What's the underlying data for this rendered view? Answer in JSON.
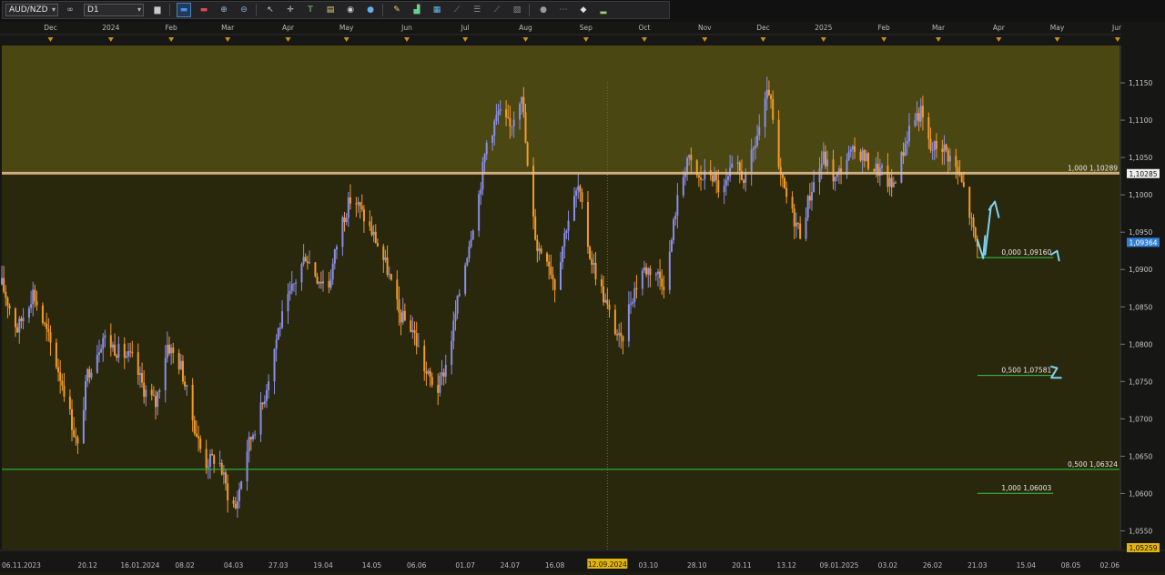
{
  "toolbar": {
    "symbol": "AUD/NZD",
    "period": "D1",
    "buttons": [
      {
        "name": "chart-type-icon",
        "glyph": "▆",
        "color": "#c9c9c9"
      },
      {
        "name": "candle-blue-icon",
        "glyph": "▬",
        "color": "#4a8fe0"
      },
      {
        "name": "candle-red-icon",
        "glyph": "▬",
        "color": "#e04a4a"
      },
      {
        "name": "zoom-in-icon",
        "glyph": "⊕",
        "color": "#8fb3e8"
      },
      {
        "name": "zoom-out-icon",
        "glyph": "⊖",
        "color": "#8fb3e8"
      },
      {
        "name": "cursor-icon",
        "glyph": "↖",
        "color": "#cfcfcf"
      },
      {
        "name": "crosshair-icon",
        "glyph": "✛",
        "color": "#cfcfcf"
      },
      {
        "name": "text-tool-icon",
        "glyph": "T",
        "color": "#9ad06a"
      },
      {
        "name": "note-icon",
        "glyph": "▤",
        "color": "#e8d36a"
      },
      {
        "name": "camera-icon",
        "glyph": "◉",
        "color": "#cfcfcf"
      },
      {
        "name": "globe-icon",
        "glyph": "●",
        "color": "#6aaee8"
      },
      {
        "name": "pencil-icon",
        "glyph": "✎",
        "color": "#f0d05a"
      },
      {
        "name": "indicator-icon",
        "glyph": "▟",
        "color": "#6ad08a"
      },
      {
        "name": "calculator-icon",
        "glyph": "▦",
        "color": "#6ab8e8"
      },
      {
        "name": "line-tool-icon",
        "glyph": "⟋",
        "color": "#8a8a8a"
      },
      {
        "name": "fibonacci-icon",
        "glyph": "☰",
        "color": "#8a8a8a"
      },
      {
        "name": "channel-icon",
        "glyph": "⟋",
        "color": "#8a8a8a"
      },
      {
        "name": "shapes-icon",
        "glyph": "▧",
        "color": "#8a8a8a"
      },
      {
        "name": "sphere-icon",
        "glyph": "●",
        "color": "#9a9a9a"
      },
      {
        "name": "more-icon",
        "glyph": "⋯",
        "color": "#8a8a8a"
      },
      {
        "name": "eraser-icon",
        "glyph": "◆",
        "color": "#e0e0e0"
      },
      {
        "name": "signal-icon",
        "glyph": "▂",
        "color": "#9ad06a"
      }
    ]
  },
  "chart_data": {
    "type": "candlestick",
    "symbol": "AUD/NZD",
    "timeframe": "D1",
    "colors": {
      "bull": "#8a8ee8",
      "bear": "#f29a2e",
      "premium_zone": "#4a4713",
      "discount_zone": "#29270c",
      "fib_line": "#35c84a",
      "resistance": "#e9c08e",
      "current_price": "#2f7fd6",
      "annotation": "#7fd2f0"
    },
    "x_dates": [
      "2023-11-06",
      "2025-06-02"
    ],
    "y_range": [
      1.0525,
      1.12
    ],
    "upper_zone": [
      1.1029,
      1.12
    ],
    "top_month_labels": [
      {
        "label": "Dec",
        "date": "2023-12-01"
      },
      {
        "label": "2024",
        "date": "2024-01-01"
      },
      {
        "label": "Feb",
        "date": "2024-02-01"
      },
      {
        "label": "Mar",
        "date": "2024-03-01"
      },
      {
        "label": "Apr",
        "date": "2024-04-01"
      },
      {
        "label": "May",
        "date": "2024-05-01"
      },
      {
        "label": "Jun",
        "date": "2024-06-01"
      },
      {
        "label": "Jul",
        "date": "2024-07-01"
      },
      {
        "label": "Aug",
        "date": "2024-08-01"
      },
      {
        "label": "Sep",
        "date": "2024-09-01"
      },
      {
        "label": "Oct",
        "date": "2024-10-01"
      },
      {
        "label": "Nov",
        "date": "2024-11-01"
      },
      {
        "label": "Dec",
        "date": "2024-12-01"
      },
      {
        "label": "2025",
        "date": "2025-01-01"
      },
      {
        "label": "Feb",
        "date": "2025-02-01"
      },
      {
        "label": "Mar",
        "date": "2025-03-01"
      },
      {
        "label": "Apr",
        "date": "2025-04-01"
      },
      {
        "label": "May",
        "date": "2025-05-01"
      },
      {
        "label": "Jun",
        "date": "2025-06-01"
      }
    ],
    "bottom_date_labels": [
      {
        "label": "06.11.2023",
        "date": "2023-11-06"
      },
      {
        "label": "20.12",
        "date": "2023-12-20"
      },
      {
        "label": "16.01.2024",
        "date": "2024-01-16"
      },
      {
        "label": "08.02",
        "date": "2024-02-08"
      },
      {
        "label": "04.03",
        "date": "2024-03-04"
      },
      {
        "label": "27.03",
        "date": "2024-03-27"
      },
      {
        "label": "19.04",
        "date": "2024-04-19"
      },
      {
        "label": "14.05",
        "date": "2024-05-14"
      },
      {
        "label": "06.06",
        "date": "2024-06-06"
      },
      {
        "label": "01.07",
        "date": "2024-07-01"
      },
      {
        "label": "24.07",
        "date": "2024-07-24"
      },
      {
        "label": "16.08",
        "date": "2024-08-16"
      },
      {
        "label": "03.10",
        "date": "2024-10-03"
      },
      {
        "label": "28.10",
        "date": "2024-10-28"
      },
      {
        "label": "20.11",
        "date": "2024-11-20"
      },
      {
        "label": "13.12",
        "date": "2024-12-13"
      },
      {
        "label": "09.01.2025",
        "date": "2025-01-09"
      },
      {
        "label": "03.02",
        "date": "2025-02-03"
      },
      {
        "label": "26.02",
        "date": "2025-02-26"
      },
      {
        "label": "21.03",
        "date": "2025-03-21"
      },
      {
        "label": "15.04",
        "date": "2025-04-15"
      },
      {
        "label": "08.05",
        "date": "2025-05-08"
      },
      {
        "label": "02.06",
        "date": "2025-06-02"
      }
    ],
    "crosshair_date": {
      "label": "12.09.2024",
      "date": "2024-09-12"
    },
    "y_ticks": [
      {
        "label": "1,1150",
        "value": 1.115
      },
      {
        "label": "1,1100",
        "value": 1.11
      },
      {
        "label": "1,1050",
        "value": 1.105
      },
      {
        "label": "1,1000",
        "value": 1.1
      },
      {
        "label": "1,0950",
        "value": 1.095
      },
      {
        "label": "1,0900",
        "value": 1.09
      },
      {
        "label": "1,0850",
        "value": 1.085
      },
      {
        "label": "1,0800",
        "value": 1.08
      },
      {
        "label": "1,0750",
        "value": 1.075
      },
      {
        "label": "1,0700",
        "value": 1.07
      },
      {
        "label": "1,0650",
        "value": 1.065
      },
      {
        "label": "1,0600",
        "value": 1.06
      },
      {
        "label": "1,0550",
        "value": 1.055
      }
    ],
    "price_badges": [
      {
        "label": "1,10285",
        "value": 1.10285,
        "style": "resistance"
      },
      {
        "label": "1,09364",
        "value": 1.09364,
        "style": "current"
      },
      {
        "label": "1,05259",
        "value": 1.05259,
        "style": "low"
      }
    ],
    "fib_levels": [
      {
        "label": "1,000 1,10289",
        "value": 1.10289,
        "from": "2023-11-06",
        "to": "2025-06-02",
        "style": "resistance"
      },
      {
        "label": "0,000 1,09160",
        "value": 1.0916,
        "from": "2025-03-21",
        "to": "2025-04-29",
        "style": "fib"
      },
      {
        "label": "0,500 1,07581",
        "value": 1.07581,
        "from": "2025-03-21",
        "to": "2025-04-29",
        "style": "fib"
      },
      {
        "label": "0,500 1,06324",
        "value": 1.06324,
        "from": "2023-11-06",
        "to": "2025-06-02",
        "style": "fib"
      },
      {
        "label": "1,000 1,06003",
        "value": 1.06003,
        "from": "2025-03-21",
        "to": "2025-04-29",
        "style": "fib"
      }
    ],
    "price_path": [
      [
        "2023-11-06",
        1.088
      ],
      [
        "2023-11-14",
        1.082
      ],
      [
        "2023-11-22",
        1.087
      ],
      [
        "2023-12-01",
        1.08
      ],
      [
        "2023-12-08",
        1.074
      ],
      [
        "2023-12-15",
        1.066
      ],
      [
        "2023-12-20",
        1.076
      ],
      [
        "2023-12-28",
        1.081
      ],
      [
        "2024-01-05",
        1.079
      ],
      [
        "2024-01-12",
        1.078
      ],
      [
        "2024-01-18",
        1.074
      ],
      [
        "2024-01-24",
        1.072
      ],
      [
        "2024-01-30",
        1.08
      ],
      [
        "2024-02-06",
        1.077
      ],
      [
        "2024-02-12",
        1.07
      ],
      [
        "2024-02-18",
        1.064
      ],
      [
        "2024-02-25",
        1.065
      ],
      [
        "2024-03-01",
        1.06
      ],
      [
        "2024-03-05",
        1.058
      ],
      [
        "2024-03-11",
        1.066
      ],
      [
        "2024-03-19",
        1.072
      ],
      [
        "2024-03-27",
        1.082
      ],
      [
        "2024-04-04",
        1.088
      ],
      [
        "2024-04-10",
        1.092
      ],
      [
        "2024-04-16",
        1.089
      ],
      [
        "2024-04-22",
        1.088
      ],
      [
        "2024-04-28",
        1.096
      ],
      [
        "2024-05-04",
        1.1
      ],
      [
        "2024-05-10",
        1.097
      ],
      [
        "2024-05-16",
        1.094
      ],
      [
        "2024-05-22",
        1.09
      ],
      [
        "2024-05-28",
        1.084
      ],
      [
        "2024-06-04",
        1.082
      ],
      [
        "2024-06-11",
        1.076
      ],
      [
        "2024-06-17",
        1.074
      ],
      [
        "2024-06-22",
        1.078
      ],
      [
        "2024-06-28",
        1.087
      ],
      [
        "2024-07-04",
        1.095
      ],
      [
        "2024-07-08",
        1.1
      ],
      [
        "2024-07-12",
        1.107
      ],
      [
        "2024-07-18",
        1.111
      ],
      [
        "2024-07-24",
        1.109
      ],
      [
        "2024-07-30",
        1.114
      ],
      [
        "2024-08-03",
        1.1
      ],
      [
        "2024-08-07",
        1.093
      ],
      [
        "2024-08-12",
        1.092
      ],
      [
        "2024-08-16",
        1.088
      ],
      [
        "2024-08-22",
        1.096
      ],
      [
        "2024-08-28",
        1.101
      ],
      [
        "2024-09-03",
        1.092
      ],
      [
        "2024-09-08",
        1.088
      ],
      [
        "2024-09-13",
        1.084
      ],
      [
        "2024-09-19",
        1.08
      ],
      [
        "2024-09-24",
        1.086
      ],
      [
        "2024-09-30",
        1.09
      ],
      [
        "2024-10-06",
        1.09
      ],
      [
        "2024-10-12",
        1.088
      ],
      [
        "2024-10-17",
        1.098
      ],
      [
        "2024-10-23",
        1.105
      ],
      [
        "2024-10-29",
        1.102
      ],
      [
        "2024-11-04",
        1.103
      ],
      [
        "2024-11-10",
        1.1
      ],
      [
        "2024-11-16",
        1.104
      ],
      [
        "2024-11-22",
        1.102
      ],
      [
        "2024-11-28",
        1.108
      ],
      [
        "2024-12-04",
        1.114
      ],
      [
        "2024-12-09",
        1.103
      ],
      [
        "2024-12-15",
        1.098
      ],
      [
        "2024-12-20",
        1.095
      ],
      [
        "2024-12-26",
        1.101
      ],
      [
        "2025-01-01",
        1.105
      ],
      [
        "2025-01-07",
        1.102
      ],
      [
        "2025-01-13",
        1.105
      ],
      [
        "2025-01-19",
        1.106
      ],
      [
        "2025-01-25",
        1.104
      ],
      [
        "2025-01-31",
        1.103
      ],
      [
        "2025-02-05",
        1.101
      ],
      [
        "2025-02-10",
        1.105
      ],
      [
        "2025-02-15",
        1.11
      ],
      [
        "2025-02-20",
        1.111
      ],
      [
        "2025-02-25",
        1.106
      ],
      [
        "2025-03-02",
        1.107
      ],
      [
        "2025-03-07",
        1.105
      ],
      [
        "2025-03-11",
        1.103
      ],
      [
        "2025-03-15",
        1.1
      ],
      [
        "2025-03-19",
        1.095
      ],
      [
        "2025-03-21",
        1.093
      ]
    ],
    "annotations": [
      {
        "name": "down-arrow-stroke",
        "stroke": "cyan",
        "points": [
          [
            "2025-03-21",
            1.094
          ],
          [
            "2025-03-24",
            1.0915
          ],
          [
            "2025-03-25",
            1.0945
          ]
        ]
      },
      {
        "name": "up-arrow-stroke",
        "stroke": "cyan",
        "points": [
          [
            "2025-03-25",
            1.092
          ],
          [
            "2025-03-28",
            1.0985
          ]
        ]
      },
      {
        "name": "up-arrow-head",
        "stroke": "cyan",
        "points": [
          [
            "2025-03-27",
            1.098
          ],
          [
            "2025-03-30",
            1.0991
          ],
          [
            "2025-04-01",
            1.097
          ]
        ]
      },
      {
        "name": "marker-one",
        "stroke": "cyan",
        "points": [
          [
            "2025-04-28",
            1.092
          ],
          [
            "2025-05-01",
            1.0925
          ],
          [
            "2025-05-02",
            1.0912
          ]
        ]
      },
      {
        "name": "marker-two",
        "stroke": "cyan",
        "points": [
          [
            "2025-04-28",
            1.077
          ],
          [
            "2025-05-01",
            1.0768
          ],
          [
            "2025-04-28",
            1.0755
          ],
          [
            "2025-05-03",
            1.0755
          ]
        ]
      }
    ]
  }
}
